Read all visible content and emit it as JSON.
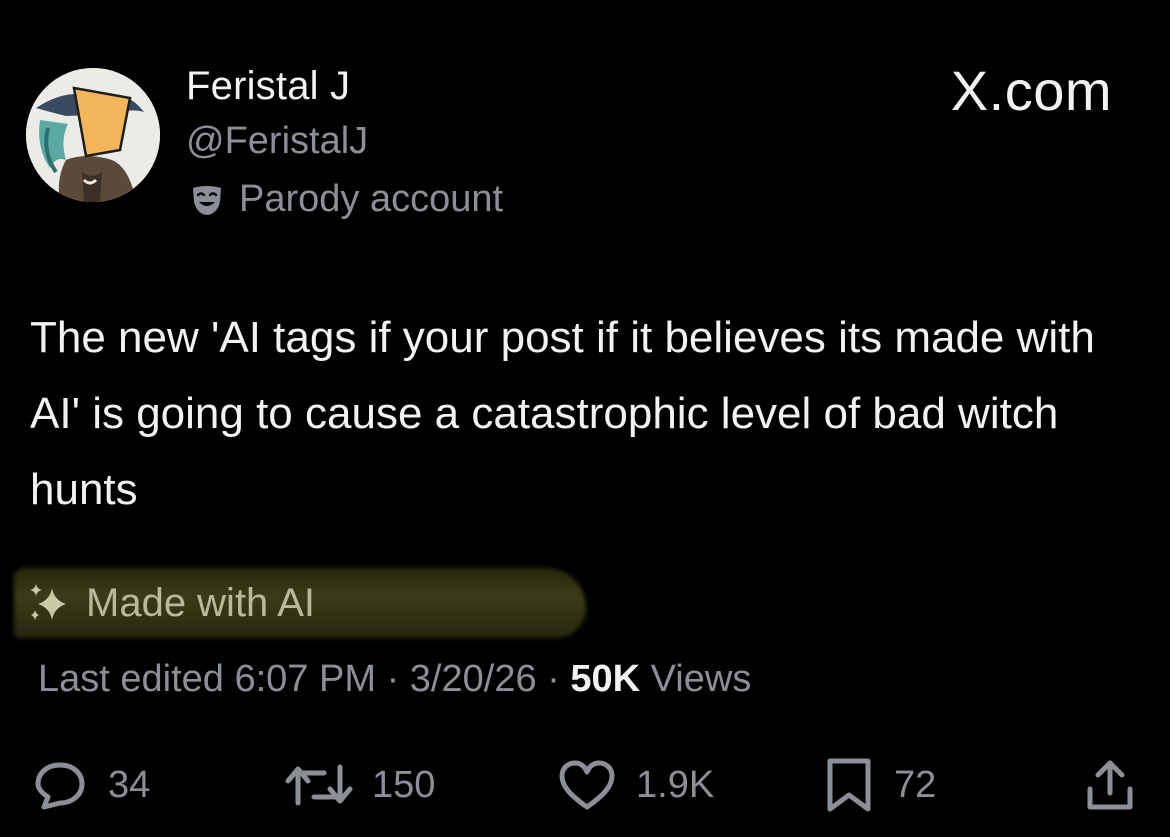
{
  "post": {
    "author": {
      "display_name": "Feristal J",
      "handle": "@FeristalJ",
      "badge_label": "Parody account",
      "badge_icon": "theater-mask-icon",
      "avatar_icon": "avatar-image"
    },
    "brand": "X.com",
    "text": "The new 'AI tags if your post if it believes its made with AI' is going to cause a catastrophic level of bad witch hunts",
    "ai_label": {
      "icon": "sparkle-icon",
      "text": "Made with AI",
      "highlight_color": "#5a5a22"
    },
    "meta": {
      "edited_prefix": "Last edited ",
      "time": "6:07 PM",
      "separator": " · ",
      "date": "3/20/26",
      "separator2": " · ",
      "views_count": "50K",
      "views_label": " Views"
    },
    "actions": {
      "replies": {
        "icon": "reply-icon",
        "count": "34"
      },
      "reposts": {
        "icon": "repost-icon",
        "count": "150"
      },
      "likes": {
        "icon": "heart-icon",
        "count": "1.9K"
      },
      "bookmarks": {
        "icon": "bookmark-icon",
        "count": "72"
      },
      "share": {
        "icon": "share-icon"
      }
    }
  },
  "colors": {
    "background": "#000000",
    "primary_text": "#f2f2f2",
    "secondary_text": "#8b9096",
    "ai_label_text": "#b8b89a"
  }
}
